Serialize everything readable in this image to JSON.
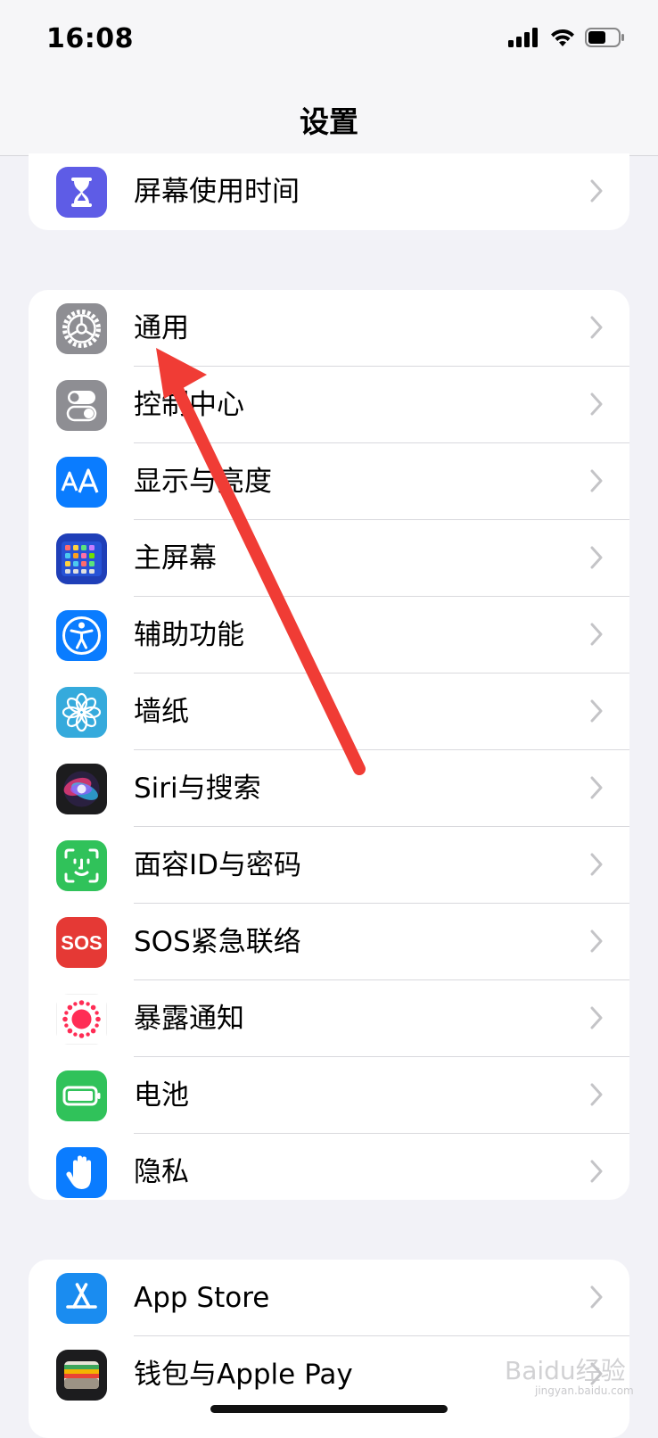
{
  "status": {
    "time": "16:08"
  },
  "nav": {
    "title": "设置"
  },
  "groups": [
    {
      "rows": [
        {
          "label": "屏幕使用时间",
          "icon": "hourglass-icon",
          "color": "#5e5ce6"
        }
      ]
    },
    {
      "rows": [
        {
          "label": "通用",
          "icon": "gear-icon",
          "color": "#8e8e93"
        },
        {
          "label": "控制中心",
          "icon": "toggles-icon",
          "color": "#8e8e93"
        },
        {
          "label": "显示与亮度",
          "icon": "text-size-icon",
          "color": "#0a7cff"
        },
        {
          "label": "主屏幕",
          "icon": "home-grid-icon",
          "color": "#2753d6"
        },
        {
          "label": "辅助功能",
          "icon": "accessibility-icon",
          "color": "#0a7cff"
        },
        {
          "label": "墙纸",
          "icon": "flower-icon",
          "color": "#35aadc"
        },
        {
          "label": "Siri与搜索",
          "icon": "siri-icon",
          "color": "#1c1c1e"
        },
        {
          "label": "面容ID与密码",
          "icon": "face-id-icon",
          "color": "#30c25a"
        },
        {
          "label": "SOS紧急联络",
          "icon": "sos-icon",
          "color": "#e53935"
        },
        {
          "label": "暴露通知",
          "icon": "exposure-icon",
          "color": "#ffffff"
        },
        {
          "label": "电池",
          "icon": "battery-icon",
          "color": "#30c25a"
        },
        {
          "label": "隐私",
          "icon": "hand-icon",
          "color": "#0a7cff"
        }
      ]
    },
    {
      "rows": [
        {
          "label": "App Store",
          "icon": "app-store-icon",
          "color": "#1a8cf0"
        },
        {
          "label": "钱包与Apple Pay",
          "icon": "wallet-icon",
          "color": "#1c1c1e"
        }
      ]
    }
  ],
  "watermark": {
    "text": "Baidu经验",
    "sub": "jingyan.baidu.com"
  }
}
